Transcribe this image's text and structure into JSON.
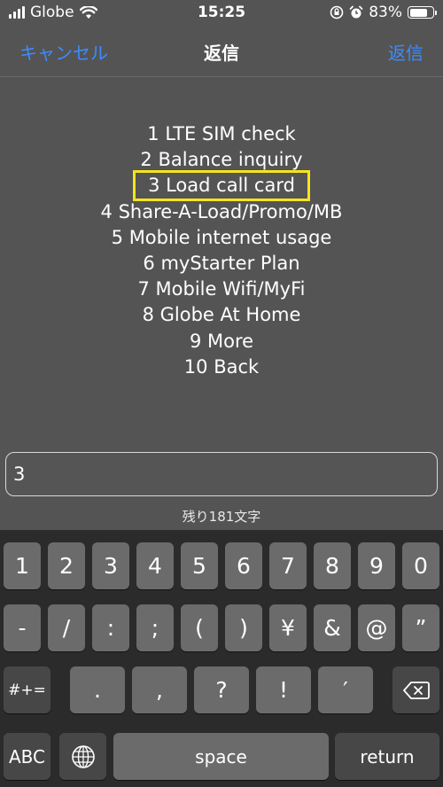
{
  "status_bar": {
    "carrier": "Globe",
    "time": "15:25",
    "battery_percent": "83%",
    "battery_level": 0.83,
    "icons": [
      "signal-icon",
      "wifi-icon",
      "orientation-lock-icon",
      "alarm-icon",
      "battery-icon"
    ]
  },
  "nav": {
    "cancel_label": "キャンセル",
    "title": "返信",
    "reply_label": "返信"
  },
  "menu": {
    "items": [
      "1 LTE SIM check",
      "2 Balance inquiry",
      "3 Load call card",
      "4 Share-A-Load/Promo/MB",
      "5 Mobile internet usage",
      "6 myStarter Plan",
      "7 Mobile Wifi/MyFi",
      "8 Globe At Home",
      "9 More",
      "10 Back"
    ],
    "highlighted_index": 2,
    "highlight_color": "#f5e51c"
  },
  "input": {
    "value": "3",
    "remaining": "残り181文字"
  },
  "keyboard": {
    "row1": [
      "1",
      "2",
      "3",
      "4",
      "5",
      "6",
      "7",
      "8",
      "9",
      "0"
    ],
    "row2": [
      "-",
      "/",
      ":",
      ";",
      "(",
      ")",
      "¥",
      "&",
      "@",
      "”"
    ],
    "row3_mode": "#+=",
    "row3": [
      ".",
      ",",
      "?",
      "!",
      "′"
    ],
    "abc_label": "ABC",
    "space_label": "space",
    "return_label": "return"
  },
  "colors": {
    "background": "#545454",
    "accent": "#3d8bff",
    "keyboard_bg": "#2b2b2b",
    "key": "#6b6b6b",
    "key_dark": "#474747"
  }
}
